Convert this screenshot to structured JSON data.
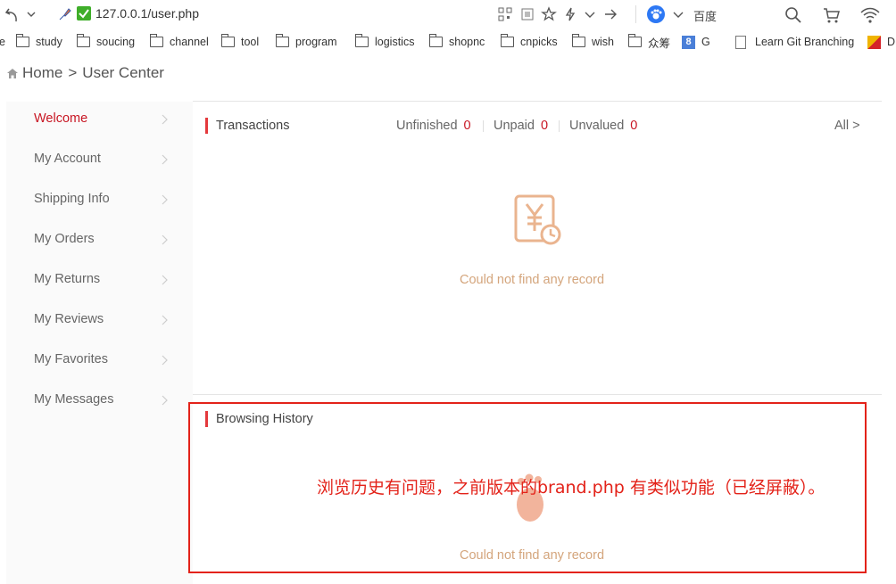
{
  "browser": {
    "url": "127.0.0.1/user.php",
    "search_engine": "百度"
  },
  "bookmarks": [
    {
      "label": "e",
      "type": "text"
    },
    {
      "label": "study",
      "type": "folder"
    },
    {
      "label": "soucing",
      "type": "folder"
    },
    {
      "label": "channel",
      "type": "folder"
    },
    {
      "label": "tool",
      "type": "folder"
    },
    {
      "label": "program",
      "type": "folder"
    },
    {
      "label": "logistics",
      "type": "folder"
    },
    {
      "label": "shopnc",
      "type": "folder"
    },
    {
      "label": "cnpicks",
      "type": "folder"
    },
    {
      "label": "wish",
      "type": "folder"
    },
    {
      "label": "众筹",
      "type": "folder"
    },
    {
      "label": "G",
      "type": "google"
    },
    {
      "label": "Learn Git Branching",
      "type": "doc"
    },
    {
      "label": "D",
      "type": "git"
    }
  ],
  "breadcrumb": {
    "home": "Home",
    "separator": ">",
    "current": "User Center"
  },
  "sidebar": {
    "items": [
      {
        "label": "Welcome",
        "active": true
      },
      {
        "label": "My Account",
        "active": false
      },
      {
        "label": "Shipping Info",
        "active": false
      },
      {
        "label": "My Orders",
        "active": false
      },
      {
        "label": "My Returns",
        "active": false
      },
      {
        "label": "My Reviews",
        "active": false
      },
      {
        "label": "My Favorites",
        "active": false
      },
      {
        "label": "My Messages",
        "active": false
      }
    ]
  },
  "transactions": {
    "title": "Transactions",
    "unfinished_label": "Unfinished",
    "unfinished_count": "0",
    "unpaid_label": "Unpaid",
    "unpaid_count": "0",
    "unvalued_label": "Unvalued",
    "unvalued_count": "0",
    "all_link": "All >",
    "empty_text": "Could not find any record"
  },
  "history": {
    "title": "Browsing History",
    "empty_text": "Could not find any record",
    "annotation": "浏览历史有问题，之前版本的brand.php 有类似功能（已经屏蔽）。"
  },
  "colors": {
    "accent": "#c81623",
    "annotation": "#e32219",
    "empty_text": "#d4a57c"
  }
}
